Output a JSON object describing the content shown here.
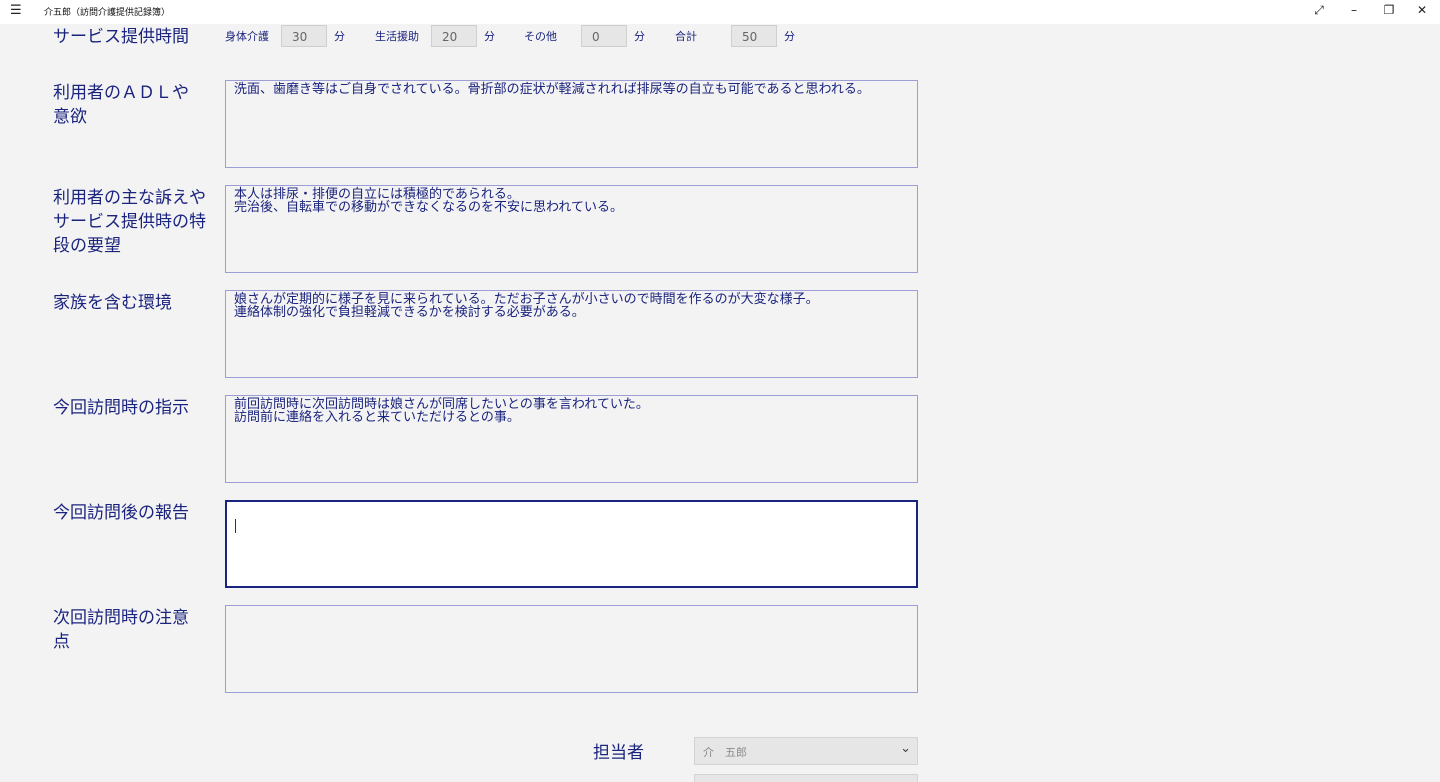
{
  "window": {
    "menu_glyph": "☰",
    "title": "介五郎（訪問介護提供記録簿）",
    "controls": {
      "expand": "⤢",
      "minimize": "–",
      "restore": "❐",
      "close": "✕"
    }
  },
  "service_time": {
    "label": "サービス提供時間",
    "physical_care": {
      "label": "身体介護",
      "value": "30",
      "unit": "分"
    },
    "life_support": {
      "label": "生活援助",
      "value": "20",
      "unit": "分"
    },
    "other": {
      "label": "その他",
      "value": "0",
      "unit": "分"
    },
    "total": {
      "label": "合計",
      "value": "50",
      "unit": "分"
    }
  },
  "fields": {
    "adl": {
      "label": "利用者のＡＤＬや意欲",
      "value": "洗面、歯磨き等はご自身でされている。骨折部の症状が軽減されれば排尿等の自立も可能であると思われる。"
    },
    "complaints": {
      "label": "利用者の主な訴えやサービス提供時の特段の要望",
      "value": "本人は排尿・排便の自立には積極的であられる。\n完治後、自転車での移動ができなくなるのを不安に思われている。"
    },
    "family": {
      "label": "家族を含む環境",
      "value": "娘さんが定期的に様子を見に来られている。ただお子さんが小さいので時間を作るのが大変な様子。\n連絡体制の強化で負担軽減できるかを検討する必要がある。"
    },
    "instructions": {
      "label": "今回訪問時の指示",
      "value": "前回訪問時に次回訪問時は娘さんが同席したいとの事を言われていた。\n訪問前に連絡を入れると来ていただけるとの事。"
    },
    "report": {
      "label": "今回訪問後の報告",
      "value": ""
    },
    "next_notes": {
      "label": "次回訪問時の注意点",
      "value": ""
    }
  },
  "staff": {
    "label": "担当者",
    "selected": "介　五郎",
    "chevron": "⌄"
  }
}
